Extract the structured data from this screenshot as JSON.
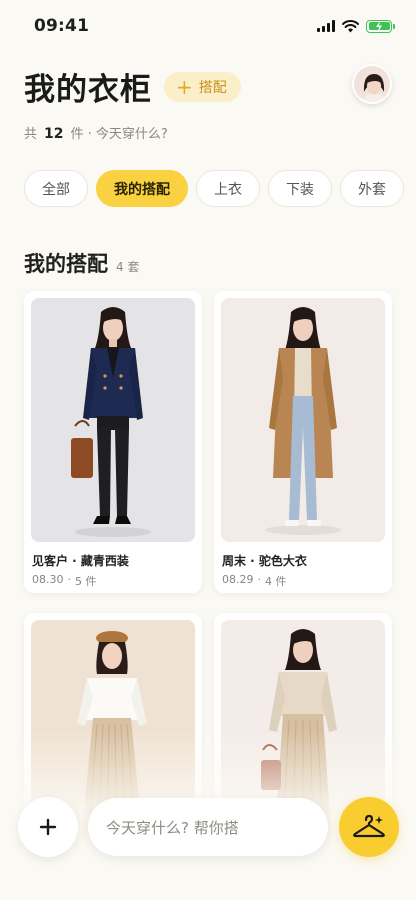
{
  "status": {
    "time": "09:41"
  },
  "header": {
    "title": "我的衣柜",
    "chip_label": "搭配",
    "subtitle_prefix": "共",
    "item_count": "12",
    "subtitle_suffix": "件 · 今天穿什么?"
  },
  "filters": [
    "全部",
    "我的搭配",
    "上衣",
    "下装",
    "外套"
  ],
  "section": {
    "title": "我的搭配",
    "count": "4 套"
  },
  "outfits": [
    {
      "title": "见客户 · 藏青西装",
      "date": "08.30",
      "pieces": "5 件"
    },
    {
      "title": "周末 · 驼色大衣",
      "date": "08.29",
      "pieces": "4 件"
    },
    {
      "title": "",
      "date": "",
      "pieces": ""
    },
    {
      "title": "",
      "date": "",
      "pieces": ""
    }
  ],
  "bottom": {
    "ask_placeholder": "今天穿什么? 帮你搭"
  },
  "colors": {
    "accent": "#fad140",
    "chip_bg": "#fbefc9",
    "chip_text": "#c8921a",
    "battery": "#3ec356"
  }
}
